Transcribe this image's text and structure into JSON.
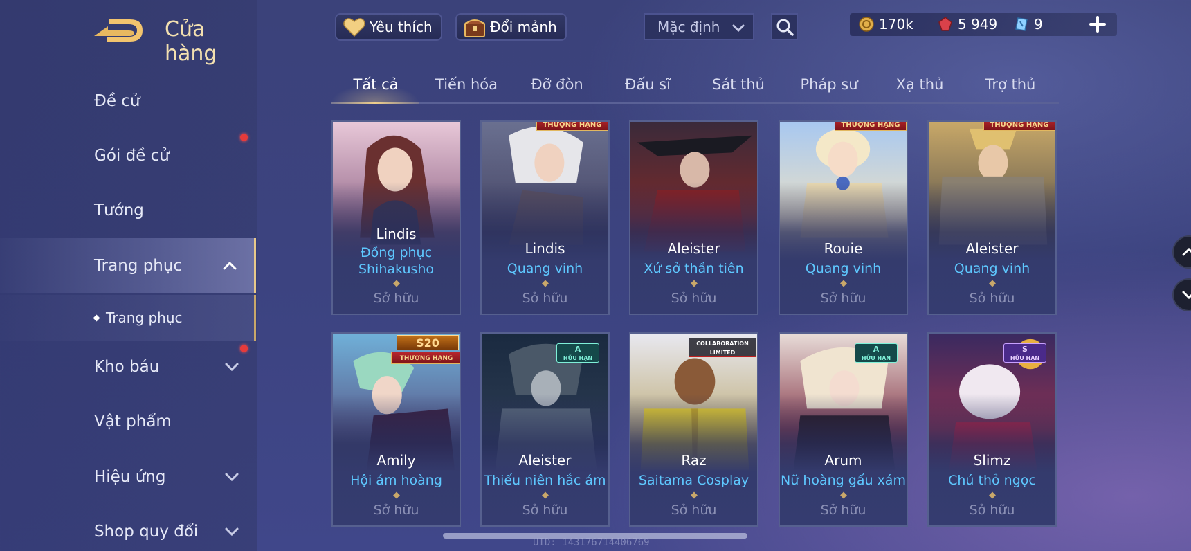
{
  "header": {
    "title": "Cửa hàng",
    "favorites_label": "Yêu thích",
    "exchange_label": "Đổi mảnh",
    "sort_selected": "Mặc định",
    "currencies": {
      "gold": "170k",
      "vouchers": "5 949",
      "shards": "9"
    }
  },
  "sidebar": {
    "items": [
      {
        "label": "Đề cử"
      },
      {
        "label": "Gói đề cử"
      },
      {
        "label": "Tướng"
      },
      {
        "label": "Trang phục"
      },
      {
        "label": "Trang phục"
      },
      {
        "label": "Kho báu"
      },
      {
        "label": "Vật phẩm"
      },
      {
        "label": "Hiệu ứng"
      },
      {
        "label": "Shop quy đổi"
      }
    ]
  },
  "tabs": [
    {
      "label": "Tất cả"
    },
    {
      "label": "Tiến hóa"
    },
    {
      "label": "Đỡ đòn"
    },
    {
      "label": "Đấu sĩ"
    },
    {
      "label": "Sát thủ"
    },
    {
      "label": "Pháp sư"
    },
    {
      "label": "Xạ thủ"
    },
    {
      "label": "Trợ thủ"
    }
  ],
  "cards": [
    {
      "hero": "Lindis",
      "skin1": "Đồng phục",
      "skin2": "Shihakusho",
      "status": "Sở hữu"
    },
    {
      "hero": "Lindis",
      "skin1": "Quang vinh",
      "status": "Sở hữu",
      "badge": "THƯỢNG HẠNG"
    },
    {
      "hero": "Aleister",
      "skin1": "Xứ sở thần tiên",
      "status": "Sở hữu"
    },
    {
      "hero": "Rouie",
      "skin1": "Quang vinh",
      "status": "Sở hữu",
      "badge": "THƯỢNG HẠNG"
    },
    {
      "hero": "Aleister",
      "skin1": "Quang vinh",
      "status": "Sở hữu",
      "badge": "THƯỢNG HẠNG"
    },
    {
      "hero": "Amily",
      "skin1": "Hội ám hoàng",
      "status": "Sở hữu",
      "badge": "THƯỢNG HẠNG",
      "badge_top": "S20"
    },
    {
      "hero": "Aleister",
      "skin1": "Thiếu niên hắc ám",
      "status": "Sở hữu",
      "badge": "HỮU HẠN",
      "badge_top": "A"
    },
    {
      "hero": "Raz",
      "skin1": "Saitama Cosplay",
      "status": "Sở hữu",
      "badge": "COLLABORATION LIMITED"
    },
    {
      "hero": "Arum",
      "skin1": "Nữ hoàng gấu xám",
      "status": "Sở hữu",
      "badge": "HỮU HẠN",
      "badge_top": "A"
    },
    {
      "hero": "Slimz",
      "skin1": "Chú thỏ ngọc",
      "status": "Sở hữu",
      "badge": "HỮU HẠN",
      "badge_top": "S"
    }
  ],
  "footer": {
    "uid": "UID: 143176714406769"
  },
  "colors": {
    "accent_gold": "#f0d08c",
    "skin_name": "#5ec8ff",
    "notification": "#e63b3b"
  }
}
